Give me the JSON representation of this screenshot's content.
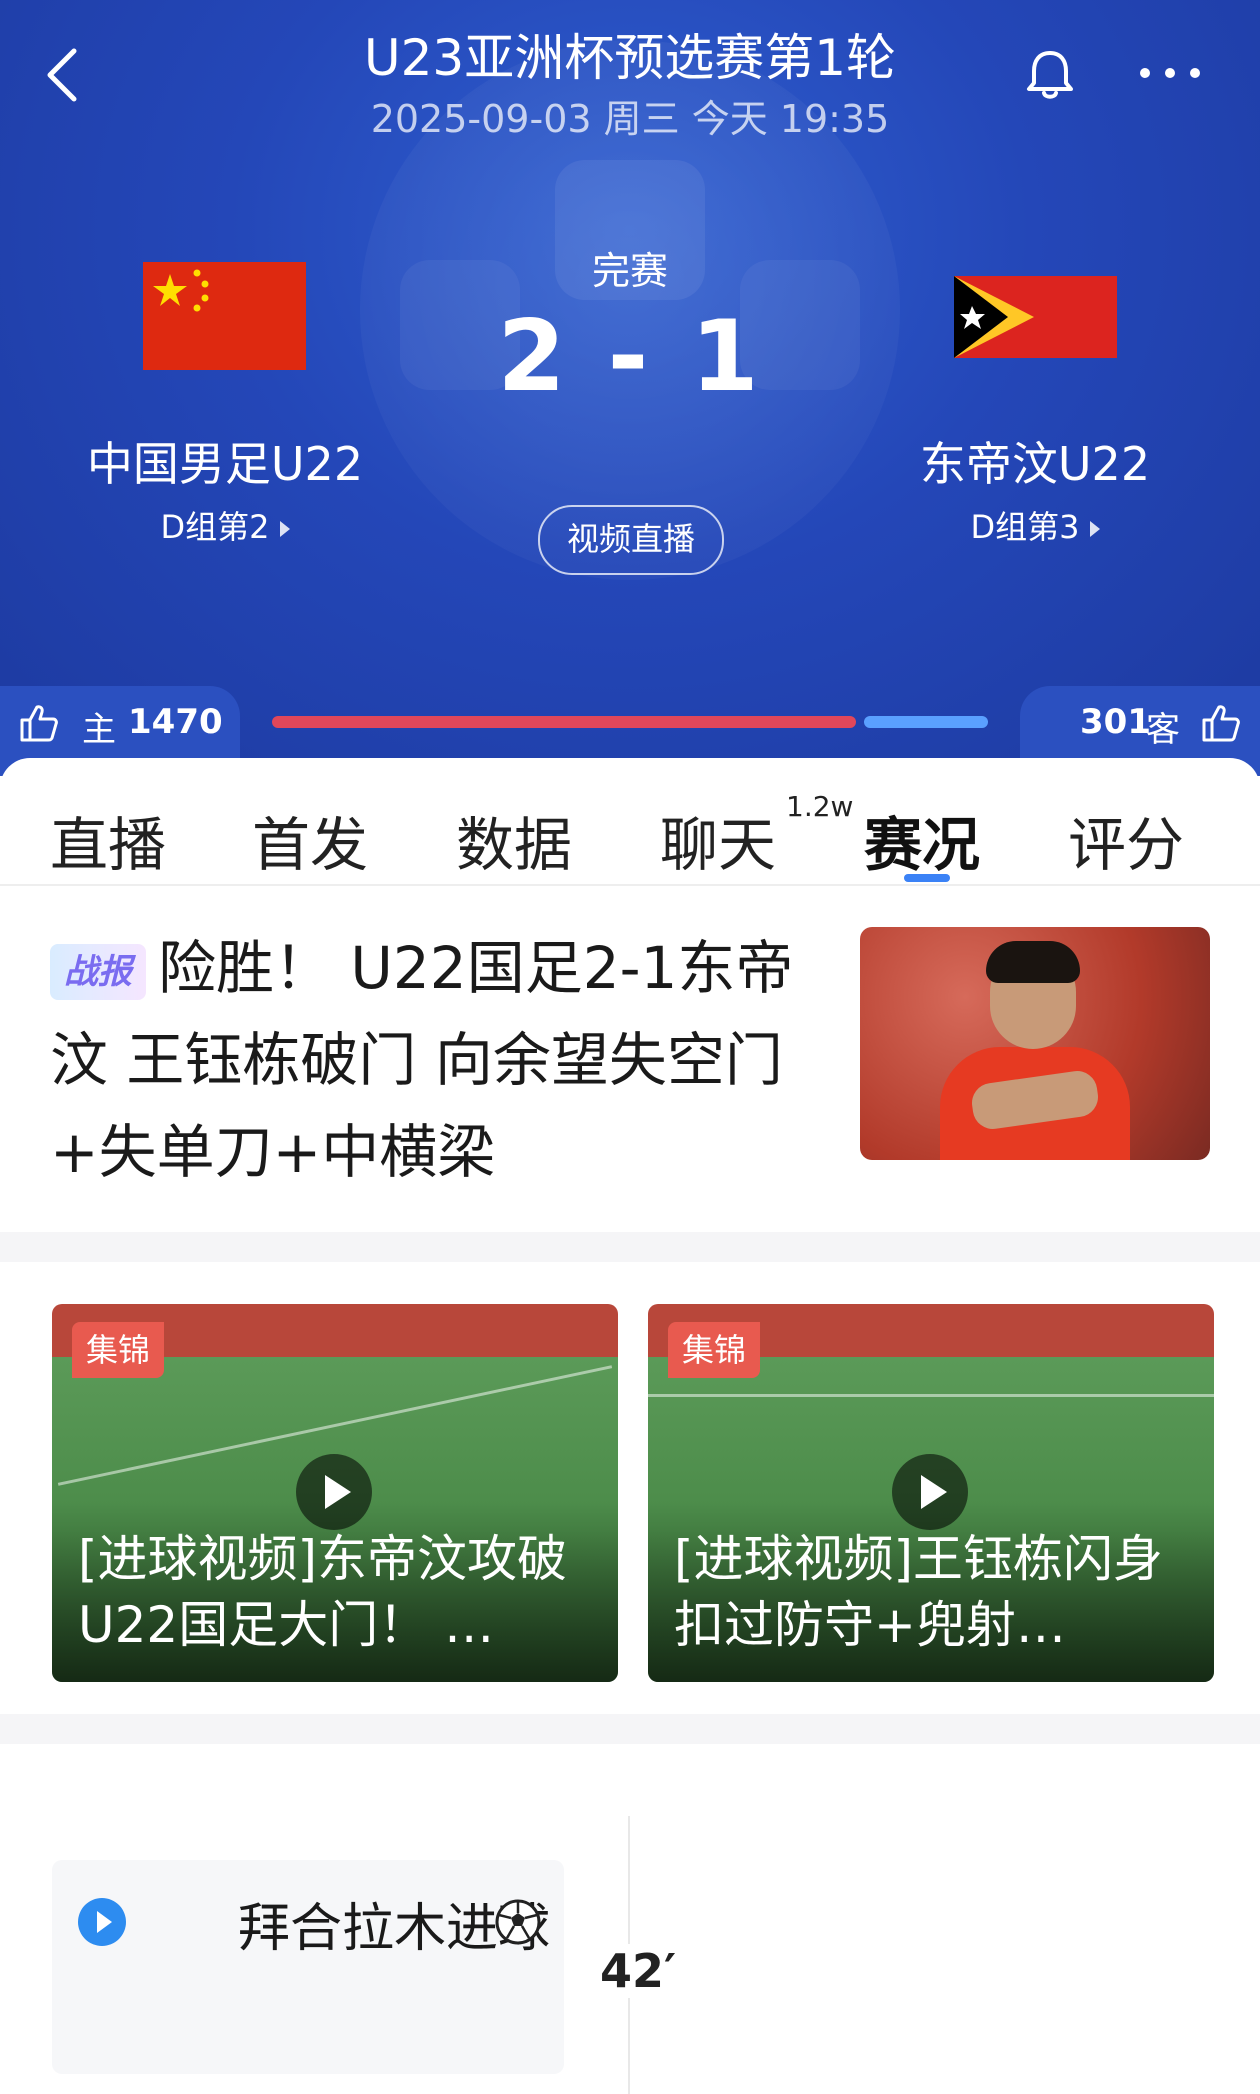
{
  "header": {
    "title": "U23亚洲杯预选赛第1轮",
    "datetime": "2025-09-03 周三 今天 19:35"
  },
  "match": {
    "status": "完赛",
    "score": "2 - 1",
    "video_button": "视频直播",
    "home": {
      "name": "中国男足U22",
      "group": "D组第2"
    },
    "away": {
      "name": "东帝汶U22",
      "group": "D组第3"
    }
  },
  "votes": {
    "home_label": "主",
    "home_count": "1470",
    "away_count": "301",
    "away_label": "客",
    "home_share": 0.83
  },
  "tabs": [
    {
      "label": "直播"
    },
    {
      "label": "首发"
    },
    {
      "label": "数据"
    },
    {
      "label": "聊天",
      "sup": "1.2w"
    },
    {
      "label": "赛况",
      "active": true
    },
    {
      "label": "评分"
    }
  ],
  "news": {
    "badge": "战报",
    "headline": "险胜！ U22国足2-1东帝汶 王钰栋破门 向余望失空门+失单刀+中横梁"
  },
  "videos": [
    {
      "tag": "集锦",
      "title": "[进球视频]东帝汶攻破U22国足大门！ …"
    },
    {
      "tag": "集锦",
      "title": "[进球视频]王钰栋闪身扣过防守+兜射…"
    }
  ],
  "timeline": [
    {
      "text": "拜合拉木进球",
      "minute": "42′",
      "icon": "soccer-ball-icon"
    }
  ],
  "colors": {
    "header_bg": "#2447b8",
    "home_bar": "#e0475a",
    "away_bar": "#5aa0ff",
    "tab_indicator": "#3b82f6",
    "tag": "#e85a4f"
  }
}
